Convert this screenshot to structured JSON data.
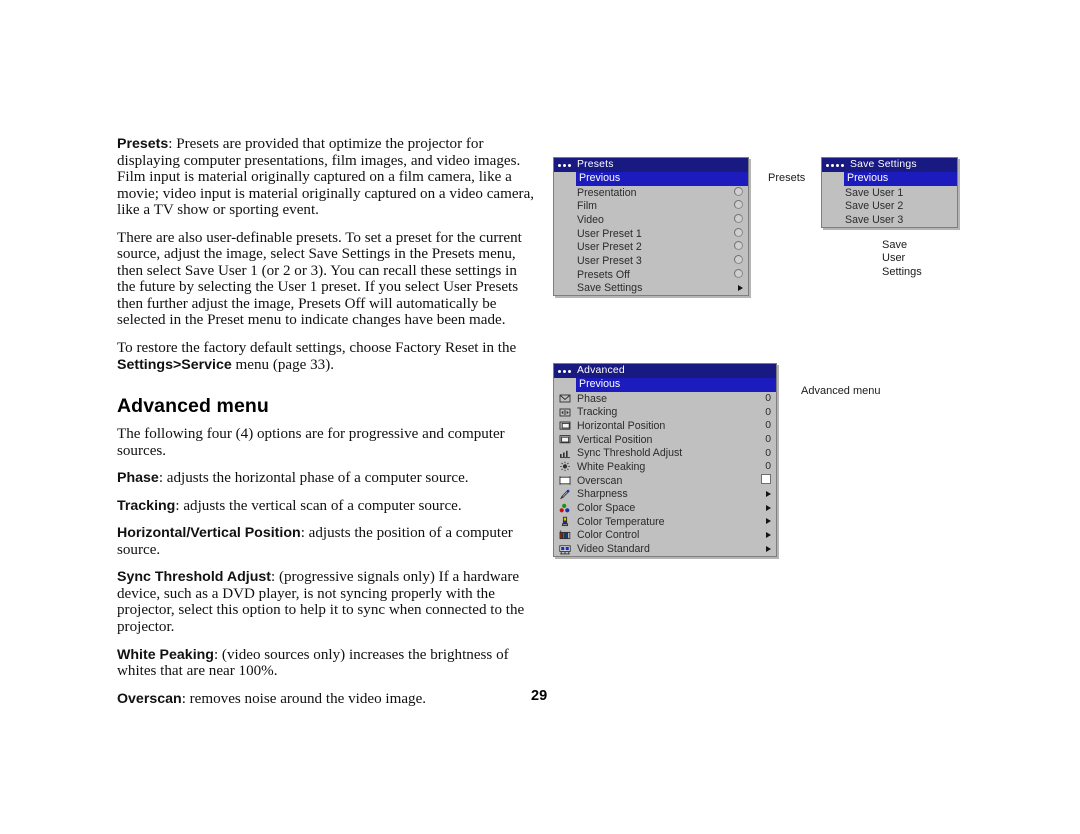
{
  "page": {
    "number": "29"
  },
  "body_text": {
    "p1_lead": "Presets",
    "p1": ": Presets are provided that optimize the projector for displaying computer presentations, film images, and video images. Film input is material originally captured on a film camera, like a movie; video input is material originally captured on a video camera, like a TV show or sporting event.",
    "p2": "There are also user-definable presets. To set a preset for the current source, adjust the image, select Save Settings in the Presets menu, then select Save User 1 (or 2 or 3). You can recall these settings in the future by selecting the User 1 preset. If you select User Presets then further adjust the image, Presets Off will automatically be selected in the Preset menu to indicate changes have been made.",
    "p3_a": "To restore the factory default settings, choose Factory Reset in the ",
    "p3_bold": "Settings>Service",
    "p3_b": " menu (page 33).",
    "section_title": "Advanced menu",
    "p4": "The following four (4) options are for progressive and computer sources.",
    "p5_lead": "Phase",
    "p5": ": adjusts the horizontal phase of a computer source.",
    "p6_lead": "Tracking",
    "p6": ": adjusts the vertical scan of a computer source.",
    "p7_lead": "Horizontal/Vertical Position",
    "p7": ": adjusts the position of a computer source.",
    "p8_lead": "Sync Threshold Adjust",
    "p8": ": (progressive signals only) If a hardware device, such as a DVD player, is not syncing properly with the projector, select this option to help it to sync when connected to the projector.",
    "p9_lead": "White Peaking",
    "p9": ": (video sources only) increases the brightness of whites that are near 100%.",
    "p10_lead": "Overscan",
    "p10": ": removes noise around the video image."
  },
  "captions": {
    "presets": "Presets",
    "save_user_settings": "Save\nUser\nSettings",
    "advanced_menu": "Advanced menu"
  },
  "presets_menu": {
    "title": "Presets",
    "title_dots": 3,
    "items": [
      {
        "label": "Previous",
        "control": "none",
        "selected": true
      },
      {
        "label": "Presentation",
        "control": "radio",
        "selected": false
      },
      {
        "label": "Film",
        "control": "radio",
        "selected": false
      },
      {
        "label": "Video",
        "control": "radio",
        "selected": false
      },
      {
        "label": "User Preset 1",
        "control": "radio",
        "selected": false
      },
      {
        "label": "User Preset 2",
        "control": "radio",
        "selected": false
      },
      {
        "label": "User Preset 3",
        "control": "radio",
        "selected": false
      },
      {
        "label": "Presets Off",
        "control": "radio",
        "selected": false
      },
      {
        "label": "Save Settings",
        "control": "arrow",
        "selected": false
      }
    ]
  },
  "save_settings_menu": {
    "title": "Save Settings",
    "title_dots": 4,
    "items": [
      {
        "label": "Previous",
        "control": "none",
        "selected": true
      },
      {
        "label": "Save User 1",
        "control": "none",
        "selected": false
      },
      {
        "label": "Save User 2",
        "control": "none",
        "selected": false
      },
      {
        "label": "Save User 3",
        "control": "none",
        "selected": false
      }
    ]
  },
  "advanced_menu": {
    "title": "Advanced",
    "title_dots": 3,
    "items": [
      {
        "label": "Previous",
        "icon": "none",
        "control": "none",
        "value": "",
        "selected": true
      },
      {
        "label": "Phase",
        "icon": "phase-icon",
        "control": "value",
        "value": "0",
        "selected": false
      },
      {
        "label": "Tracking",
        "icon": "tracking-icon",
        "control": "value",
        "value": "0",
        "selected": false
      },
      {
        "label": "Horizontal Position",
        "icon": "h-position-icon",
        "control": "value",
        "value": "0",
        "selected": false
      },
      {
        "label": "Vertical Position",
        "icon": "v-position-icon",
        "control": "value",
        "value": "0",
        "selected": false
      },
      {
        "label": "Sync Threshold Adjust",
        "icon": "sync-icon",
        "control": "value",
        "value": "0",
        "selected": false
      },
      {
        "label": "White Peaking",
        "icon": "white-peaking-icon",
        "control": "value",
        "value": "0",
        "selected": false
      },
      {
        "label": "Overscan",
        "icon": "overscan-icon",
        "control": "checkbox",
        "value": "",
        "selected": false
      },
      {
        "label": "Sharpness",
        "icon": "sharpness-icon",
        "control": "arrow",
        "value": "",
        "selected": false
      },
      {
        "label": "Color Space",
        "icon": "color-space-icon",
        "control": "arrow",
        "value": "",
        "selected": false
      },
      {
        "label": "Color Temperature",
        "icon": "color-temp-icon",
        "control": "arrow",
        "value": "",
        "selected": false
      },
      {
        "label": "Color Control",
        "icon": "color-control-icon",
        "control": "arrow",
        "value": "",
        "selected": false
      },
      {
        "label": "Video Standard",
        "icon": "video-standard-icon",
        "control": "arrow",
        "value": "",
        "selected": false
      }
    ]
  },
  "colors": {
    "menu_background": "#c0c0c0",
    "title_bar": "#191982",
    "highlight": "#1b1bbe",
    "title_text": "#ffffff",
    "item_text": "#2b2b2b"
  }
}
